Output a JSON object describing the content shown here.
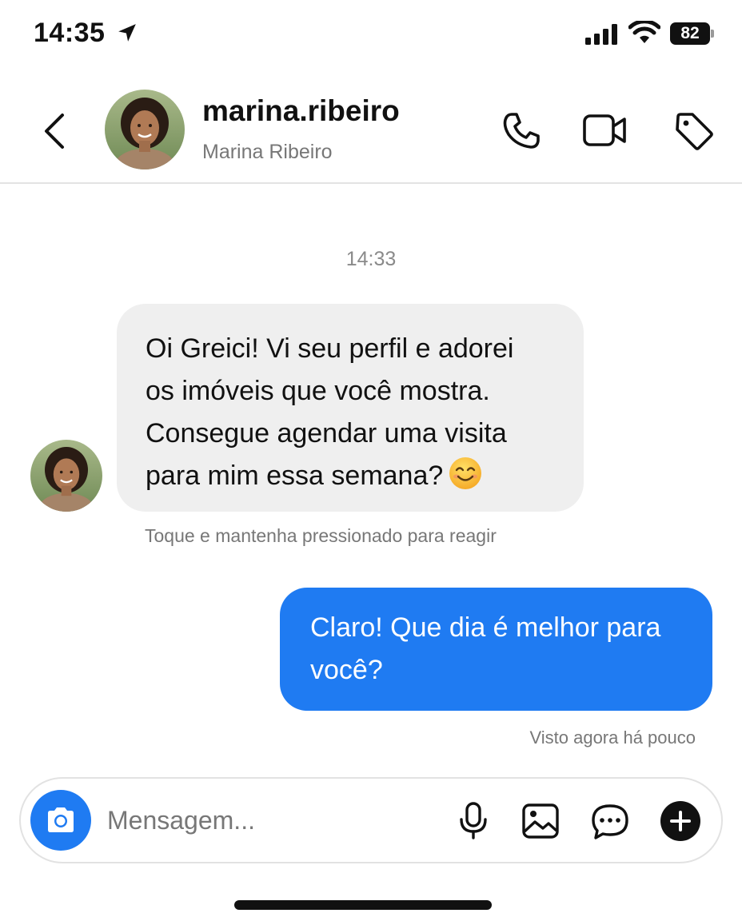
{
  "status_bar": {
    "time": "14:35",
    "battery_level": "82",
    "icons": [
      "location-arrow-icon",
      "cellular-signal-icon",
      "wifi-icon",
      "battery-icon"
    ]
  },
  "header": {
    "username": "marina.ribeiro",
    "display_name": "Marina Ribeiro",
    "icons": [
      "back-chevron-icon",
      "phone-icon",
      "video-camera-icon",
      "tag-icon"
    ]
  },
  "chat": {
    "timestamp": "14:33",
    "incoming_message": {
      "line1": "Oi Greici! Vi seu perfil e adorei",
      "line2": "os imóveis que você mostra.",
      "line3": "Consegue agendar uma visita",
      "line4": "para mim essa semana?",
      "emoji": "smiling-face-emoji"
    },
    "react_hint": "Toque e mantenha pressionado para reagir",
    "outgoing_message": {
      "line1": "Claro! Que dia é melhor para",
      "line2": "você?"
    },
    "seen_status": "Visto agora há pouco"
  },
  "composer": {
    "placeholder": "Mensagem...",
    "icons": [
      "camera-icon",
      "microphone-icon",
      "image-icon",
      "sticker-icon",
      "plus-icon"
    ]
  },
  "colors": {
    "accent_blue": "#1f7bf2",
    "incoming_bubble": "#efefef",
    "secondary_text": "#777777"
  }
}
